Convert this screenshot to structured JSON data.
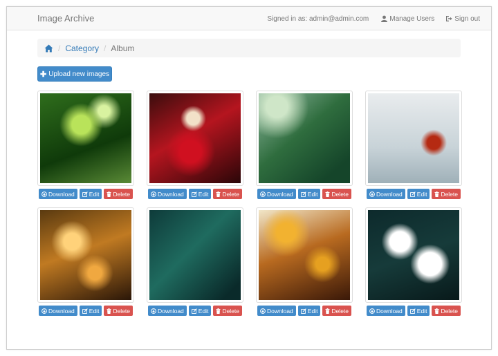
{
  "app": {
    "brand": "Image Archive"
  },
  "navbar": {
    "signed_in_text": "Signed in as: admin@admin.com",
    "manage_users": "Manage Users",
    "sign_out": "Sign out"
  },
  "breadcrumb": {
    "category": "Category",
    "album": "Album"
  },
  "toolbar": {
    "upload_label": "Upload new images"
  },
  "actions": {
    "download": "Download",
    "edit": "Edit",
    "delete": "Delete"
  },
  "colors": {
    "primary": "#428bca",
    "danger": "#d9534f",
    "link": "#337ab7"
  },
  "images": [
    {
      "subject": "green leaf sprout"
    },
    {
      "subject": "red leaves with white flower"
    },
    {
      "subject": "green fir branches"
    },
    {
      "subject": "red butterfly on branch"
    },
    {
      "subject": "golden backlit grass"
    },
    {
      "subject": "teal fir branches"
    },
    {
      "subject": "autumn tree leaves"
    },
    {
      "subject": "white blossoms"
    }
  ]
}
